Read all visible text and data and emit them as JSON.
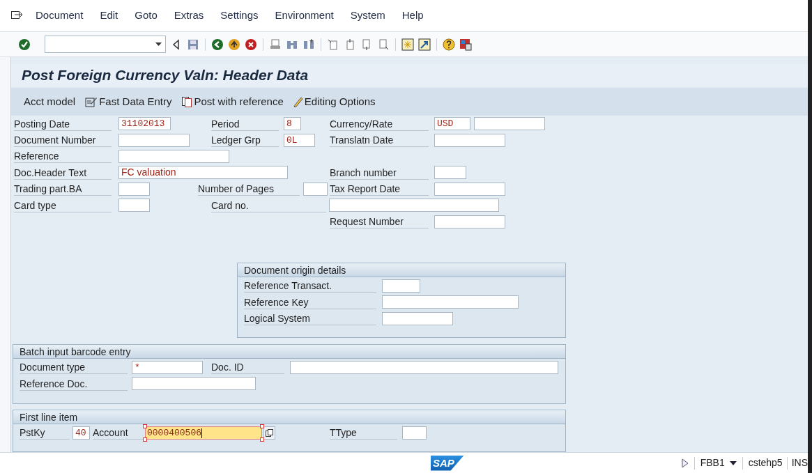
{
  "menu": [
    {
      "label": "Document"
    },
    {
      "label": "Edit"
    },
    {
      "label": "Goto"
    },
    {
      "label": "Extras"
    },
    {
      "label": "Settings"
    },
    {
      "label": "Environment"
    },
    {
      "label": "System"
    },
    {
      "label": "Help"
    }
  ],
  "title": "Post Foreign Currency Valn: Header Data",
  "app_toolbar": [
    {
      "kind": "plain",
      "label": "Acct model"
    },
    {
      "kind": "form",
      "label": "Fast Data Entry"
    },
    {
      "kind": "copy",
      "label": "Post with reference"
    },
    {
      "kind": "pencil",
      "label": "Editing Options"
    }
  ],
  "header": {
    "rows": [
      [
        {
          "kind": "label",
          "text": "Posting Date"
        },
        {
          "kind": "field",
          "value": "31102013",
          "focused": false
        },
        {
          "kind": "label",
          "text": "Period"
        },
        {
          "kind": "field",
          "value": "8",
          "focused": false
        },
        {
          "kind": "label",
          "text": "Currency/Rate"
        },
        {
          "kind": "field",
          "value": "USD",
          "focused": false
        },
        {
          "kind": "field",
          "focused": false
        }
      ],
      [
        {
          "kind": "label",
          "text": "Document Number"
        },
        {
          "kind": "field",
          "focused": false
        },
        {
          "kind": "label",
          "text": "Ledger Grp"
        },
        {
          "kind": "field",
          "value": "0L",
          "focused": false
        },
        {
          "kind": "label",
          "text": "Translatn Date"
        },
        {
          "kind": "field",
          "focused": false
        }
      ],
      [
        {
          "kind": "label",
          "text": "Reference"
        },
        {
          "kind": "field",
          "focused": false
        }
      ],
      [
        {
          "kind": "label",
          "text": "Doc.Header Text"
        },
        {
          "kind": "textfield",
          "value": "FC valuation",
          "focused": false
        },
        null,
        null,
        {
          "kind": "label",
          "text": "Branch number"
        },
        {
          "kind": "field",
          "focused": false
        }
      ],
      [
        {
          "kind": "label",
          "text": "Trading part.BA"
        },
        {
          "kind": "field",
          "focused": false
        },
        {
          "kind": "label",
          "text": "Number of Pages"
        },
        {
          "kind": "field",
          "focused": false
        },
        {
          "kind": "label",
          "text": "Tax Report Date"
        },
        {
          "kind": "field",
          "focused": false
        }
      ],
      [
        {
          "kind": "label",
          "text": "Card type"
        },
        {
          "kind": "field",
          "focused": false
        },
        {
          "kind": "label",
          "text": "Card no."
        },
        null,
        {
          "kind": "field",
          "focused": false
        }
      ],
      [
        null,
        null,
        null,
        null,
        {
          "kind": "label",
          "text": "Request Number"
        },
        {
          "kind": "field",
          "focused": false
        }
      ]
    ]
  },
  "origin": {
    "title": "Document origin details",
    "rows": [
      [
        {
          "kind": "label",
          "text": "Reference Transact."
        },
        {
          "kind": "field",
          "focused": false
        }
      ],
      [
        {
          "kind": "label",
          "text": "Reference Key"
        },
        {
          "kind": "field",
          "focused": false
        }
      ],
      [
        {
          "kind": "label",
          "text": "Logical System"
        },
        {
          "kind": "field",
          "focused": false
        }
      ]
    ]
  },
  "batch": {
    "title": "Batch input barcode entry",
    "rows": [
      [
        {
          "kind": "label",
          "text": "Document type"
        },
        {
          "kind": "field",
          "value": "*",
          "focused": false
        },
        {
          "kind": "label",
          "text": "Doc. ID"
        },
        {
          "kind": "field",
          "focused": false
        }
      ],
      [
        {
          "kind": "label",
          "text": "Reference Doc."
        },
        {
          "kind": "field",
          "focused": false
        }
      ]
    ]
  },
  "first_line": {
    "title": "First line item",
    "rows": [
      [
        {
          "kind": "label",
          "text": "PstKy"
        },
        {
          "kind": "field",
          "value": "40",
          "focused": false
        },
        {
          "kind": "label",
          "text": "Account"
        },
        {
          "kind": "field",
          "value": "0000400506",
          "focused": true
        },
        {
          "kind": "help"
        },
        {
          "kind": "label",
          "text": "TType"
        },
        {
          "kind": "field",
          "focused": false
        }
      ]
    ]
  },
  "status": {
    "logo": "SAP",
    "transaction": "FBB1",
    "user": "cstehp5",
    "mode": "INS"
  }
}
